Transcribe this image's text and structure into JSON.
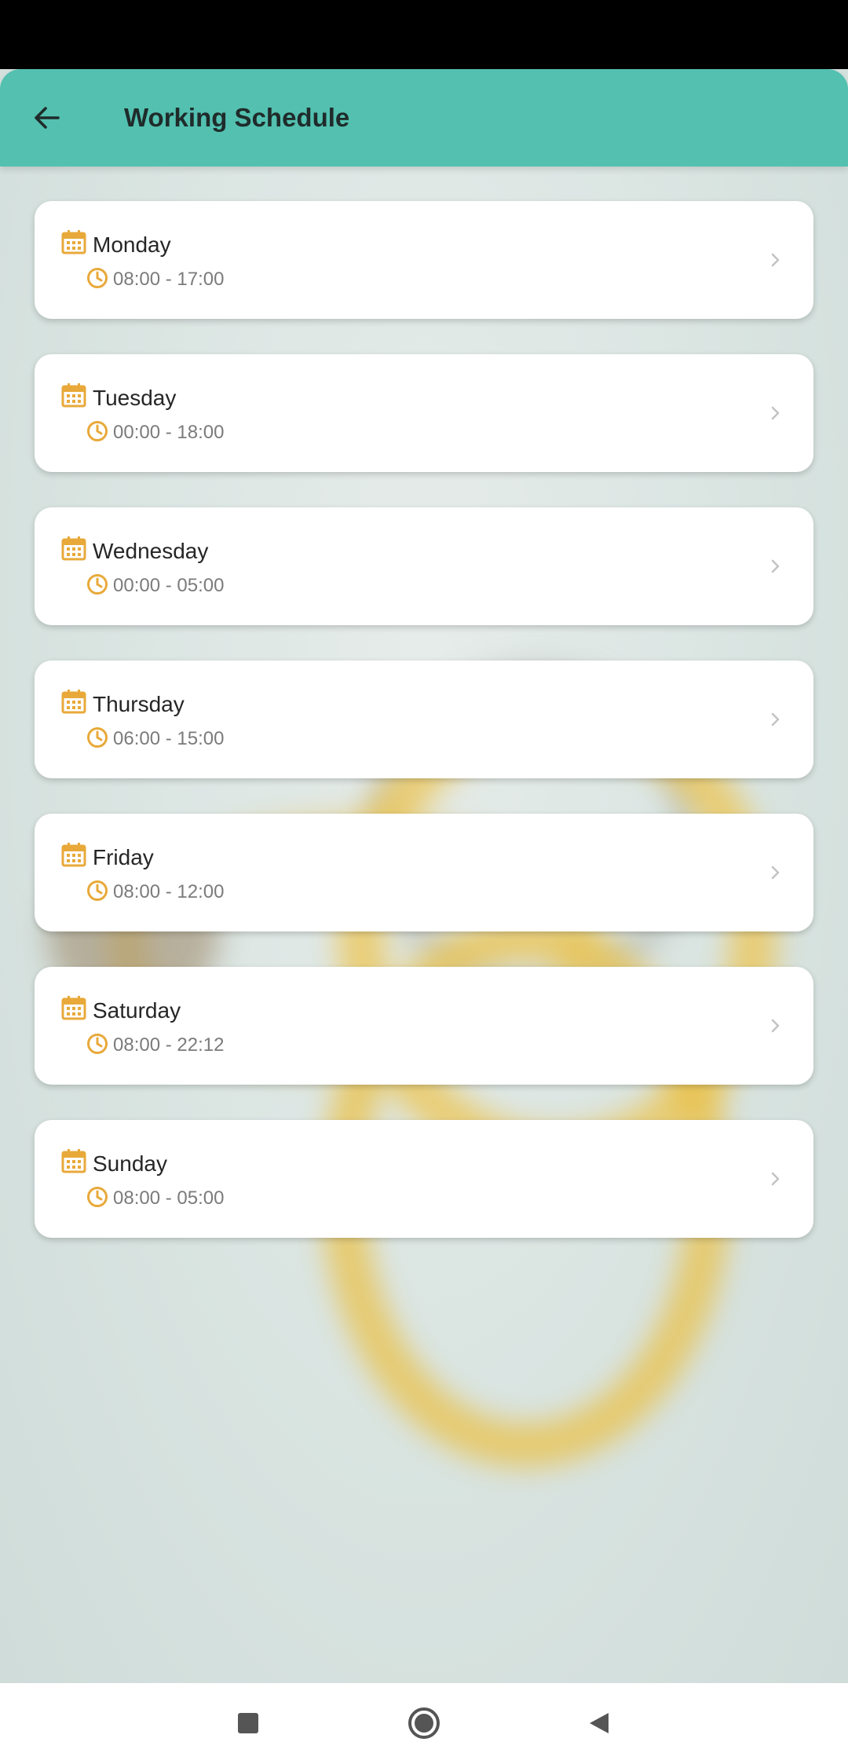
{
  "app_bar": {
    "title": "Working Schedule",
    "back_icon": "arrow-left-icon",
    "background_color": "#53c0b0"
  },
  "schedule": [
    {
      "day": "Monday",
      "time": "08:00 - 17:00"
    },
    {
      "day": "Tuesday",
      "time": "00:00 - 18:00"
    },
    {
      "day": "Wednesday",
      "time": "00:00 - 05:00"
    },
    {
      "day": "Thursday",
      "time": "06:00 - 15:00"
    },
    {
      "day": "Friday",
      "time": "08:00 - 12:00"
    },
    {
      "day": "Saturday",
      "time": "08:00 - 22:12"
    },
    {
      "day": "Sunday",
      "time": "08:00 - 05:00"
    }
  ],
  "icons": {
    "day": "calendar-icon",
    "time": "clock-icon",
    "row_action": "chevron-right-icon"
  },
  "colors": {
    "accent": "#e8a93a",
    "card": "#ffffff",
    "time_text": "#7b7b7b"
  },
  "nav_bar": {
    "buttons": [
      "recent-apps-icon",
      "home-icon",
      "back-icon"
    ]
  }
}
